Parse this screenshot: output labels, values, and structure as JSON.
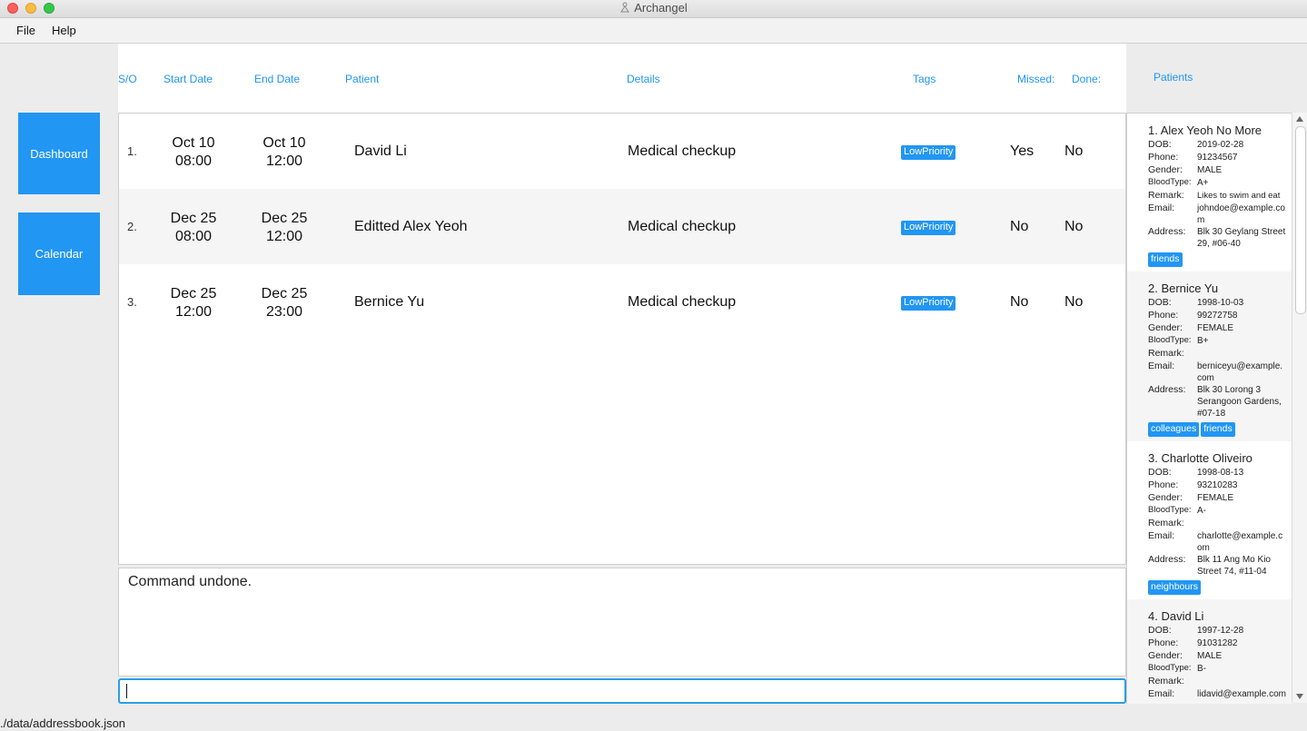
{
  "window": {
    "title": "Archangel"
  },
  "menu": {
    "file": "File",
    "help": "Help"
  },
  "sidebar": {
    "dashboard": "Dashboard",
    "calendar": "Calendar"
  },
  "appointments": {
    "headers": {
      "so": "S/O",
      "start": "Start Date",
      "end": "End Date",
      "patient": "Patient",
      "details": "Details",
      "tags": "Tags",
      "missed": "Missed:",
      "done": "Done:"
    },
    "rows": [
      {
        "index": "1.",
        "start_date": "Oct 10",
        "start_time": "08:00",
        "end_date": "Oct 10",
        "end_time": "12:00",
        "patient": "David Li",
        "details": "Medical checkup",
        "tag": "LowPriority",
        "missed": "Yes",
        "done": "No"
      },
      {
        "index": "2.",
        "start_date": "Dec 25",
        "start_time": "08:00",
        "end_date": "Dec 25",
        "end_time": "12:00",
        "patient": "Editted Alex Yeoh",
        "details": "Medical checkup",
        "tag": "LowPriority",
        "missed": "No",
        "done": "No"
      },
      {
        "index": "3.",
        "start_date": "Dec 25",
        "start_time": "12:00",
        "end_date": "Dec 25",
        "end_time": "23:00",
        "patient": "Bernice Yu",
        "details": "Medical checkup",
        "tag": "LowPriority",
        "missed": "No",
        "done": "No"
      }
    ]
  },
  "result": {
    "message": "Command undone."
  },
  "command": {
    "value": ""
  },
  "status": {
    "path": "./data/addressbook.json"
  },
  "patients": {
    "title": "Patients",
    "labels": {
      "dob": "DOB:",
      "phone": "Phone:",
      "gender": "Gender:",
      "blood": "BloodType:",
      "remark": "Remark:",
      "email": "Email:",
      "address": "Address:"
    },
    "list": [
      {
        "name": "1. Alex Yeoh No More",
        "dob": "2019-02-28",
        "phone": "91234567",
        "gender": "MALE",
        "blood": "A+",
        "remark": "Likes to swim and eat",
        "email": "johndoe@example.co\nm",
        "address": "Blk 30 Geylang Street\n29, #06-40",
        "tags": [
          "friends"
        ]
      },
      {
        "name": "2. Bernice Yu",
        "dob": "1998-10-03",
        "phone": "99272758",
        "gender": "FEMALE",
        "blood": "B+",
        "remark": "",
        "email": "berniceyu@example.\ncom",
        "address": "Blk 30 Lorong 3\nSerangoon Gardens,\n#07-18",
        "tags": [
          "colleagues",
          "friends"
        ]
      },
      {
        "name": "3. Charlotte Oliveiro",
        "dob": "1998-08-13",
        "phone": "93210283",
        "gender": "FEMALE",
        "blood": "A-",
        "remark": "",
        "email": "charlotte@example.c\nom",
        "address": "Blk 11 Ang Mo Kio\nStreet 74, #11-04",
        "tags": [
          "neighbours"
        ]
      },
      {
        "name": "4. David Li",
        "dob": "1997-12-28",
        "phone": "91031282",
        "gender": "MALE",
        "blood": "B-",
        "remark": "",
        "email": "lidavid@example.com",
        "address": "",
        "tags": []
      }
    ]
  },
  "colors": {
    "accent": "#2196f3",
    "input_border": "#29a0e0"
  }
}
